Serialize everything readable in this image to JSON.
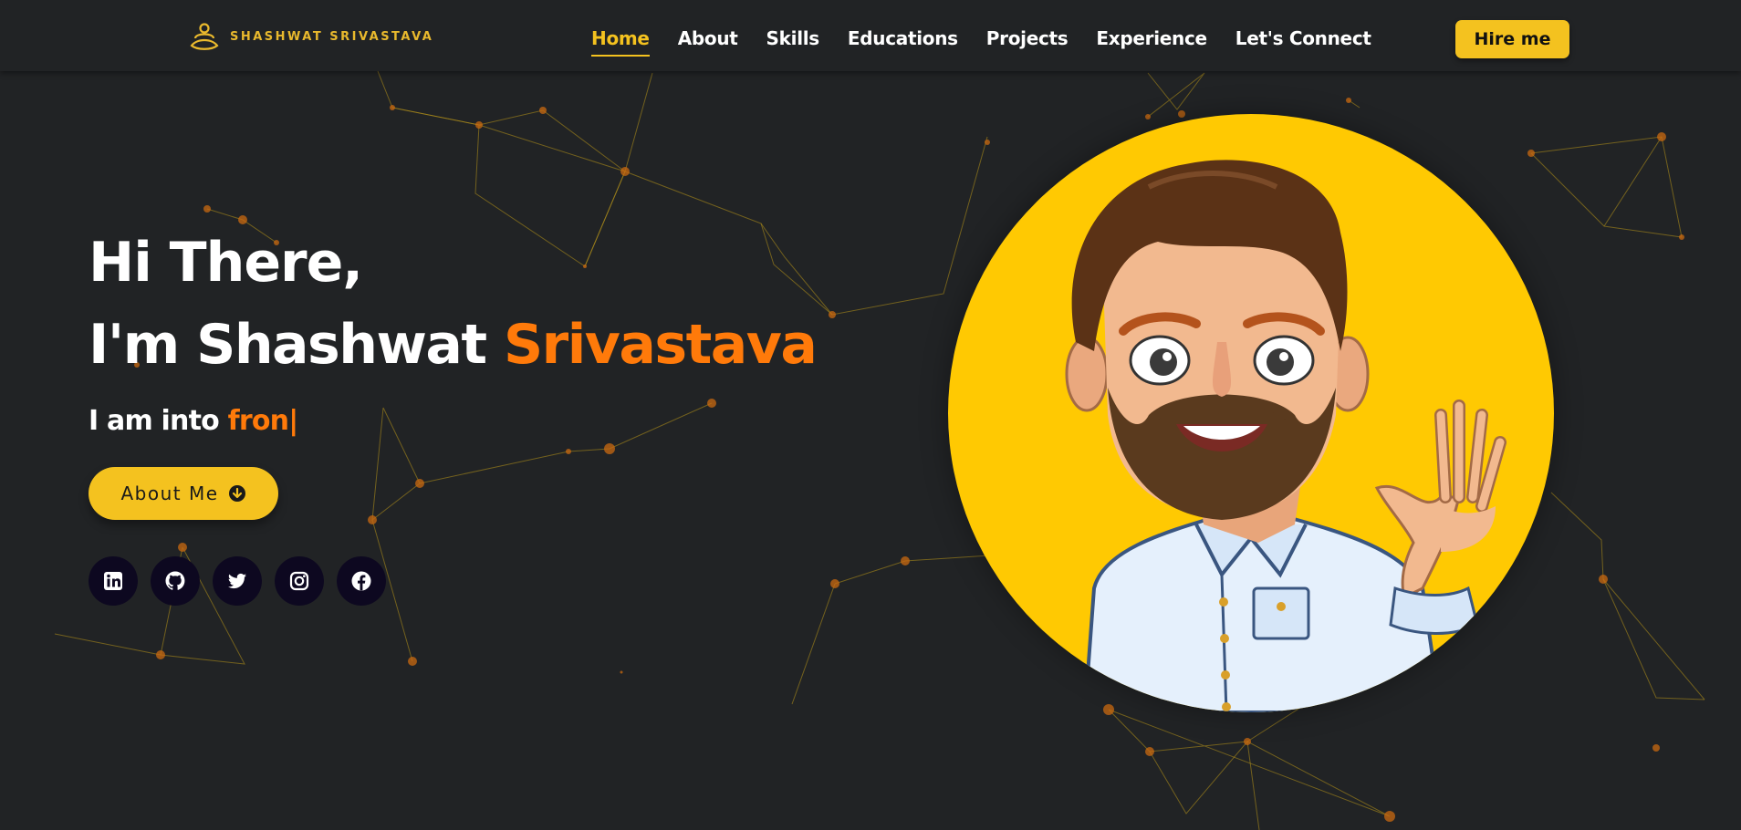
{
  "brand": {
    "name": "SHASHWAT SRIVASTAVA",
    "accent_color": "#f4c21f",
    "highlight_color": "#ff7a0a"
  },
  "nav": {
    "links": [
      {
        "label": "Home",
        "active": true
      },
      {
        "label": "About"
      },
      {
        "label": "Skills"
      },
      {
        "label": "Educations"
      },
      {
        "label": "Projects"
      },
      {
        "label": "Experience"
      },
      {
        "label": "Let's Connect"
      }
    ],
    "hire_label": "Hire me"
  },
  "hero": {
    "greeting": "Hi There,",
    "intro_prefix": "I'm Shashwat ",
    "intro_highlight": "Srivastava",
    "typed_prefix": "I am into ",
    "typed_text": "fron|",
    "about_button_label": "About Me",
    "about_button_icon": "arrow-circle-down-icon"
  },
  "socials": [
    {
      "name": "linkedin",
      "icon": "linkedin-icon"
    },
    {
      "name": "github",
      "icon": "github-icon"
    },
    {
      "name": "twitter",
      "icon": "twitter-icon"
    },
    {
      "name": "instagram",
      "icon": "instagram-icon"
    },
    {
      "name": "facebook",
      "icon": "facebook-icon"
    }
  ],
  "avatar": {
    "description_icon": "waving-cartoon-avatar",
    "background_color": "#ffc902"
  }
}
